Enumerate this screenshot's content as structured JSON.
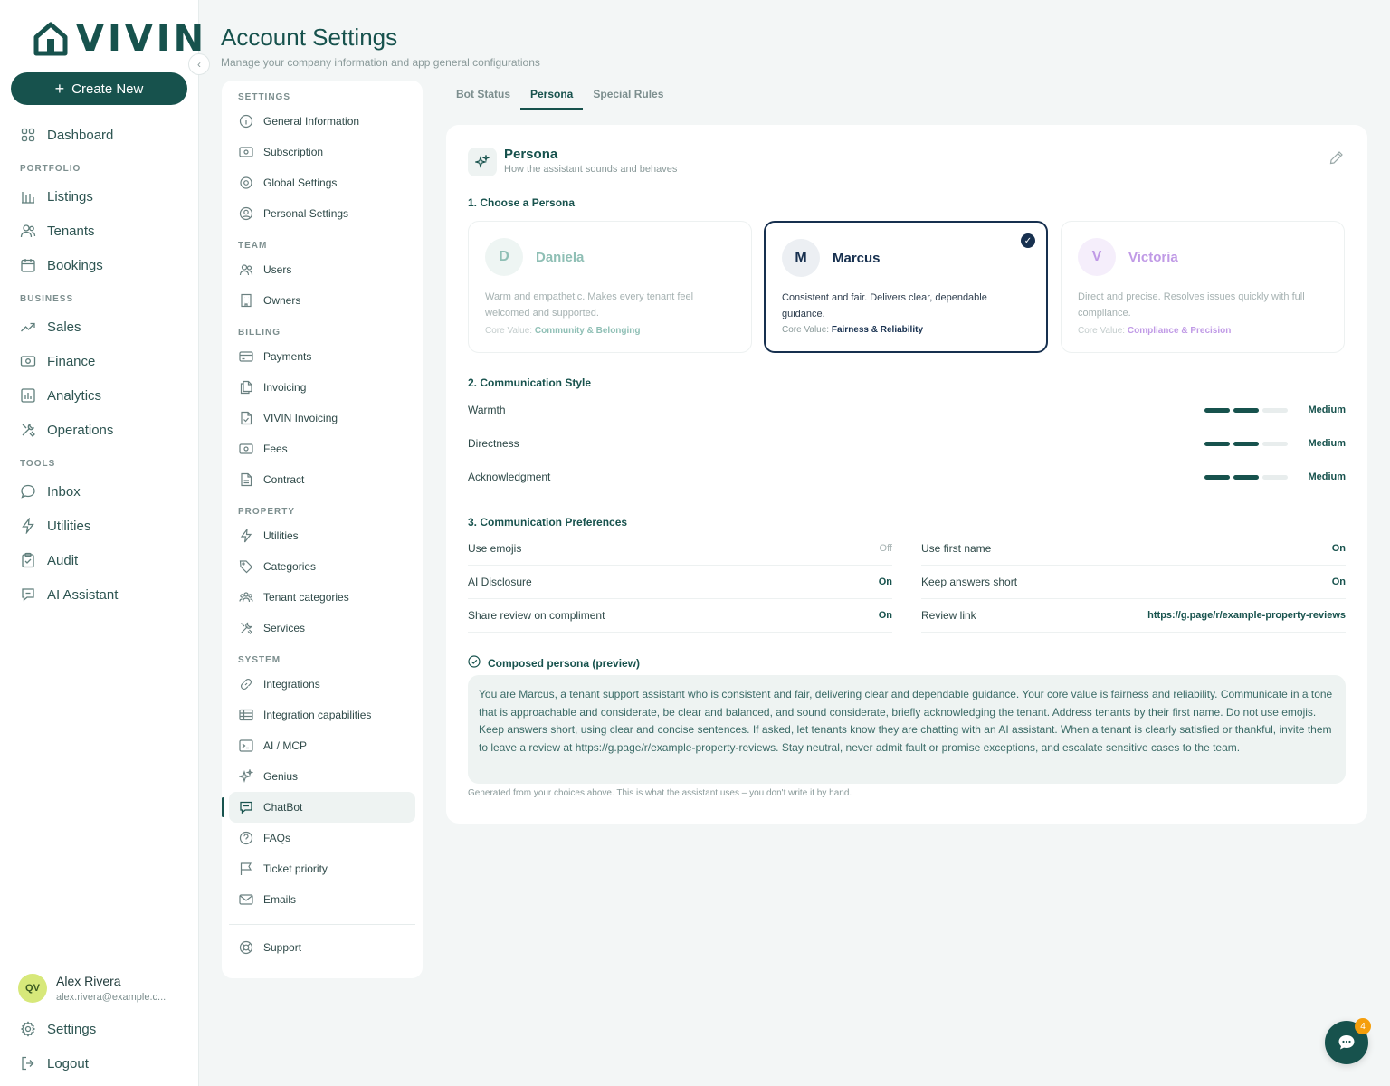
{
  "brand": {
    "name": "VIVIN",
    "color": "#17524d"
  },
  "sidebar": {
    "create_label": "Create New",
    "dashboard": "Dashboard",
    "sections": {
      "portfolio": "PORTFOLIO",
      "business": "BUSINESS",
      "tools": "TOOLS"
    },
    "portfolio_items": [
      "Listings",
      "Tenants",
      "Bookings"
    ],
    "business_items": [
      "Sales",
      "Finance",
      "Analytics",
      "Operations"
    ],
    "tools_items": [
      "Inbox",
      "Utilities",
      "Audit",
      "AI Assistant"
    ],
    "user": {
      "initials": "QV",
      "name": "Alex Rivera",
      "email": "alex.rivera@example.c..."
    },
    "settings_label": "Settings",
    "logout_label": "Logout"
  },
  "header": {
    "title": "Account Settings",
    "subtitle": "Manage your company information and app general configurations"
  },
  "settings_nav": {
    "settings_title": "SETTINGS",
    "settings_items": [
      "General Information",
      "Subscription",
      "Global Settings",
      "Personal Settings"
    ],
    "team_title": "TEAM",
    "team_items": [
      "Users",
      "Owners"
    ],
    "billing_title": "BILLING",
    "billing_items": [
      "Payments",
      "Invoicing",
      "VIVIN Invoicing",
      "Fees",
      "Contract"
    ],
    "property_title": "PROPERTY",
    "property_items": [
      "Utilities",
      "Categories",
      "Tenant categories",
      "Services"
    ],
    "system_title": "SYSTEM",
    "system_items": [
      "Integrations",
      "Integration capabilities",
      "AI / MCP",
      "Genius",
      "ChatBot",
      "FAQs",
      "Ticket priority",
      "Emails"
    ],
    "active": "ChatBot",
    "support_label": "Support"
  },
  "tabs": [
    {
      "label": "Bot Status",
      "active": false
    },
    {
      "label": "Persona",
      "active": true
    },
    {
      "label": "Special Rules",
      "active": false
    }
  ],
  "card": {
    "title": "Persona",
    "subtitle": "How the assistant sounds and behaves",
    "step1": "1. Choose a Persona",
    "step2": "2. Communication Style",
    "step3": "3. Communication Preferences",
    "core_value_label": "Core Value:",
    "personas": [
      {
        "initial": "D",
        "name": "Daniela",
        "desc": "Warm and empathetic. Makes every tenant feel welcomed and supported.",
        "core": "Community & Belonging",
        "selected": false,
        "accent": "#7fb8ad"
      },
      {
        "initial": "M",
        "name": "Marcus",
        "desc": "Consistent and fair. Delivers clear, dependable guidance.",
        "core": "Fairness & Reliability",
        "selected": true,
        "accent": "#17304f"
      },
      {
        "initial": "V",
        "name": "Victoria",
        "desc": "Direct and precise. Resolves issues quickly with full compliance.",
        "core": "Compliance & Precision",
        "selected": false,
        "accent": "#b98ee0"
      }
    ],
    "style": [
      {
        "label": "Warmth",
        "level": 2,
        "max": 3,
        "value": "Medium"
      },
      {
        "label": "Directness",
        "level": 2,
        "max": 3,
        "value": "Medium"
      },
      {
        "label": "Acknowledgment",
        "level": 2,
        "max": 3,
        "value": "Medium"
      }
    ],
    "prefs": {
      "left": [
        {
          "label": "Use emojis",
          "value": "Off"
        },
        {
          "label": "AI Disclosure",
          "value": "On"
        },
        {
          "label": "Share review on compliment",
          "value": "On"
        }
      ],
      "right": [
        {
          "label": "Use first name",
          "value": "On"
        },
        {
          "label": "Keep answers short",
          "value": "On"
        },
        {
          "label": "Review link",
          "value": "https://g.page/r/example-property-reviews"
        }
      ]
    },
    "composed_title": "Composed persona (preview)",
    "composed_text": "You are Marcus, a tenant support assistant who is consistent and fair, delivering clear and dependable guidance. Your core value is fairness and reliability. Communicate in a tone that is approachable and considerate, be clear and balanced, and sound considerate, briefly acknowledging the tenant. Address tenants by their first name. Do not use emojis. Keep answers short, using clear and concise sentences. If asked, let tenants know they are chatting with an AI assistant. When a tenant is clearly satisfied or thankful, invite them to leave a review at https://g.page/r/example-property-reviews. Stay neutral, never admit fault or promise exceptions, and escalate sensitive cases to the team.",
    "composed_note": "Generated from your choices above. This is what the assistant uses – you don't write it by hand."
  },
  "chat_fab": {
    "badge": "4"
  }
}
